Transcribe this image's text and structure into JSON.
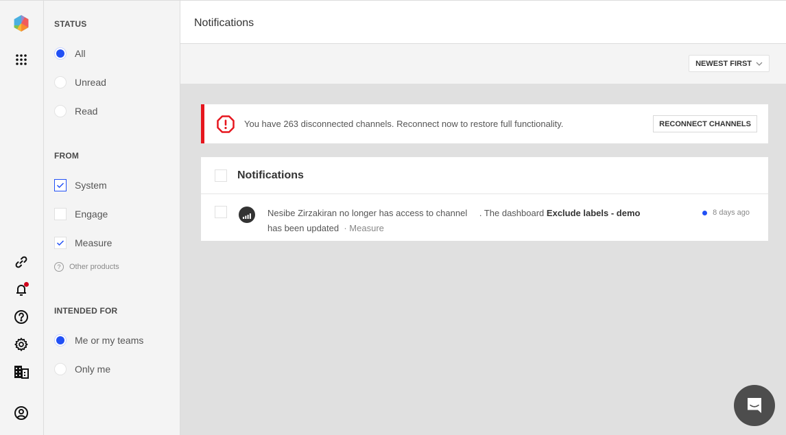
{
  "rail": {
    "icons": [
      "logo-icon",
      "apps-grid-icon",
      "link-icon",
      "bell-icon",
      "help-icon",
      "settings-icon",
      "organization-icon",
      "account-icon"
    ],
    "bell_has_badge": true,
    "badge_color": "#d0021b"
  },
  "filters": {
    "status": {
      "title": "STATUS",
      "options": [
        {
          "label": "All",
          "selected": true
        },
        {
          "label": "Unread",
          "selected": false
        },
        {
          "label": "Read",
          "selected": false
        }
      ]
    },
    "from": {
      "title": "FROM",
      "options": [
        {
          "label": "System",
          "checked": true
        },
        {
          "label": "Engage",
          "checked": false
        },
        {
          "label": "Measure",
          "checked": true
        }
      ],
      "other_products_label": "Other products"
    },
    "intended_for": {
      "title": "INTENDED FOR",
      "options": [
        {
          "label": "Me or my teams",
          "selected": true
        },
        {
          "label": "Only me",
          "selected": false
        }
      ]
    }
  },
  "header": {
    "title": "Notifications"
  },
  "toolbar": {
    "sort_label": "NEWEST FIRST"
  },
  "alert": {
    "message": "You have 263 disconnected channels. Reconnect now to restore full functionality.",
    "button_label": "RECONNECT CHANNELS",
    "accent_color": "#e6161e"
  },
  "list": {
    "title": "Notifications",
    "items": [
      {
        "text_before": "Nesibe Zirzakiran no longer has access to channel",
        "text_middle": ". The dashboard",
        "bold": "Exclude labels - demo",
        "text_after": "has been updated",
        "source": "Measure",
        "time": "8 days ago",
        "unread": true
      }
    ]
  },
  "colors": {
    "primary": "#2150f5"
  }
}
